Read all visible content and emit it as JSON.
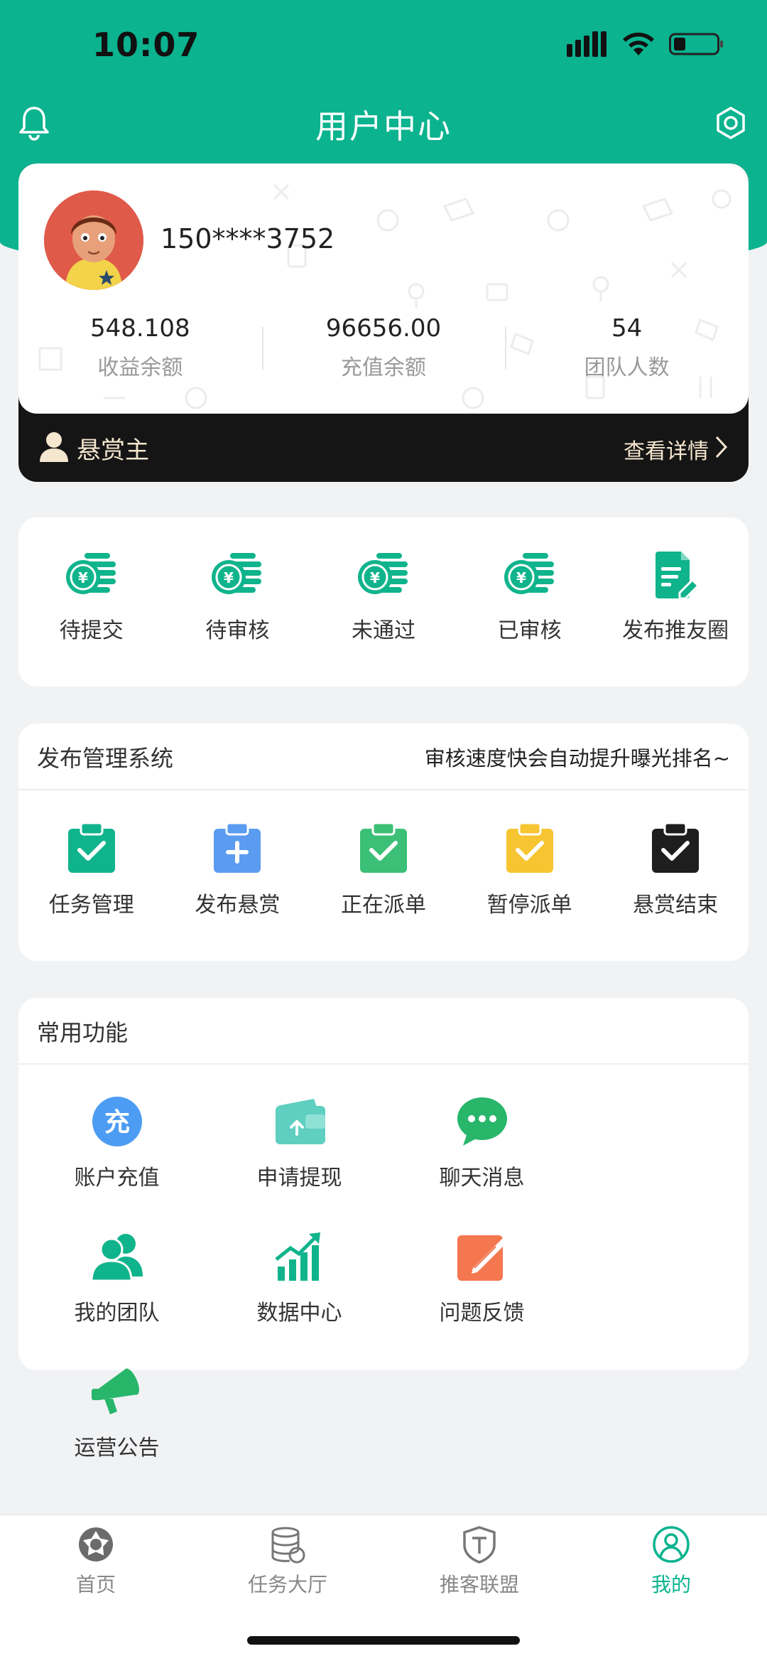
{
  "status": {
    "time": "10:07"
  },
  "header": {
    "title": "用户中心"
  },
  "profile": {
    "phone": "150****3752",
    "stats": [
      {
        "value": "548.108",
        "label": "收益余额"
      },
      {
        "value": "96656.00",
        "label": "充值余额"
      },
      {
        "value": "54",
        "label": "团队人数"
      }
    ],
    "role": "悬赏主",
    "detail": "查看详情"
  },
  "orders": [
    {
      "label": "待提交",
      "icon": "coin-stack-icon"
    },
    {
      "label": "待审核",
      "icon": "coin-stack-icon"
    },
    {
      "label": "未通过",
      "icon": "coin-stack-icon"
    },
    {
      "label": "已审核",
      "icon": "coin-stack-icon"
    },
    {
      "label": "发布推友圈",
      "icon": "document-edit-icon"
    }
  ],
  "publish": {
    "title": "发布管理系统",
    "note": "审核速度快会自动提升曝光排名~",
    "items": [
      {
        "label": "任务管理",
        "color": "#10b48c"
      },
      {
        "label": "发布悬赏",
        "color": "#5b9cf0"
      },
      {
        "label": "正在派单",
        "color": "#3cbf76"
      },
      {
        "label": "暂停派单",
        "color": "#f7c531"
      },
      {
        "label": "悬赏结束",
        "color": "#1e1e1e"
      }
    ]
  },
  "common": {
    "title": "常用功能",
    "items": [
      {
        "label": "账户充值",
        "icon": "recharge-icon",
        "glyph": "充"
      },
      {
        "label": "申请提现",
        "icon": "wallet-icon"
      },
      {
        "label": "聊天消息",
        "icon": "chat-icon"
      },
      {
        "label": "我的团队",
        "icon": "team-icon"
      },
      {
        "label": "数据中心",
        "icon": "chart-growth-icon"
      },
      {
        "label": "问题反馈",
        "icon": "feedback-edit-icon"
      },
      {
        "label": "运营公告",
        "icon": "megaphone-icon"
      }
    ]
  },
  "tabbar": [
    {
      "label": "首页",
      "icon": "aperture-icon",
      "active": false
    },
    {
      "label": "任务大厅",
      "icon": "database-icon",
      "active": false
    },
    {
      "label": "推客联盟",
      "icon": "shield-t-icon",
      "active": false
    },
    {
      "label": "我的",
      "icon": "user-circle-icon",
      "active": true
    }
  ],
  "colors": {
    "primary": "#0bb38f",
    "dark": "#151515",
    "gold": "#f5e6cf"
  }
}
